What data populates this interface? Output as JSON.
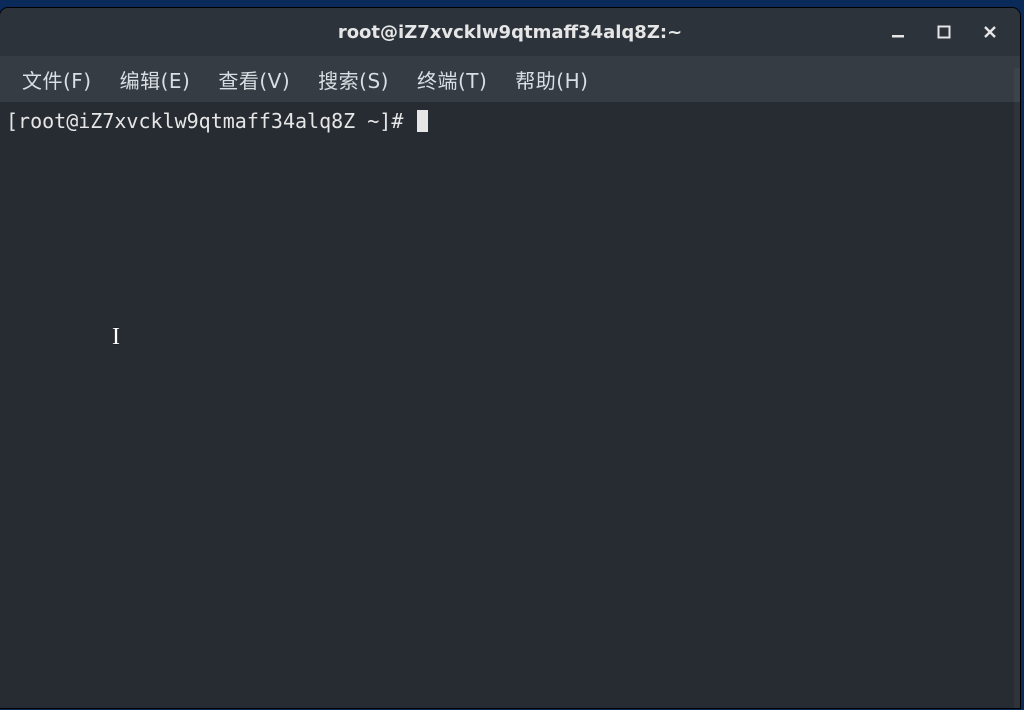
{
  "window": {
    "title": "root@iZ7xvcklw9qtmaff34alq8Z:~"
  },
  "menu": {
    "file": "文件(F)",
    "edit": "编辑(E)",
    "view": "查看(V)",
    "search": "搜索(S)",
    "terminal": "终端(T)",
    "help": "帮助(H)"
  },
  "terminal": {
    "prompt": "[root@iZ7xvcklw9qtmaff34alq8Z ~]# "
  },
  "colors": {
    "titlebar": "#2c333b",
    "menubar": "#353c44",
    "terminal_bg": "#272c33",
    "fg": "#e6e6e6"
  }
}
